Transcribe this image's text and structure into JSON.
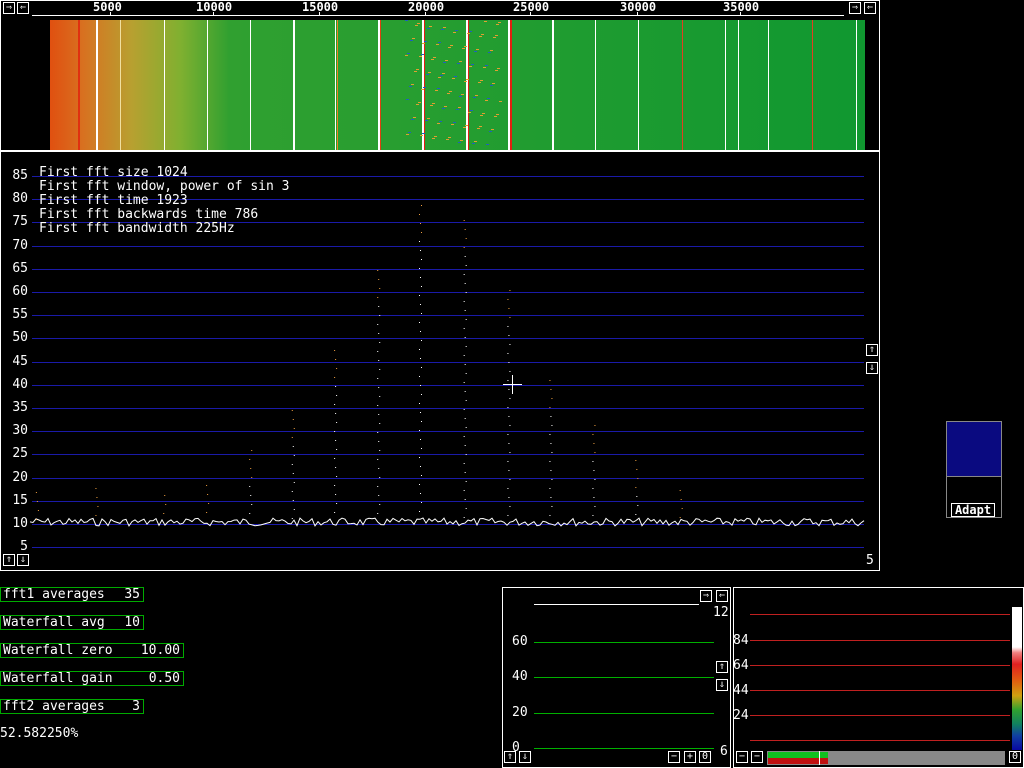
{
  "freq_axis": {
    "labels": [
      "5000",
      "10000",
      "15000",
      "20000",
      "25000",
      "30000",
      "35000"
    ]
  },
  "spectrum": {
    "y_labels": [
      "85",
      "80",
      "75",
      "70",
      "65",
      "60",
      "55",
      "50",
      "45",
      "40",
      "35",
      "30",
      "25",
      "20",
      "15",
      "10",
      "5"
    ],
    "info_lines": [
      "First fft size 1024",
      "First fft window, power of sin 3",
      "First fft time 1923",
      "First fft backwards time 786",
      "First fft bandwidth 225Hz"
    ],
    "corner_value": "5"
  },
  "params": [
    {
      "label": "fft1 averages",
      "value": "35"
    },
    {
      "label": "Waterfall avg",
      "value": "10"
    },
    {
      "label": "Waterfall zero",
      "value": "10.00"
    },
    {
      "label": "Waterfall gain",
      "value": "0.50"
    },
    {
      "label": "fft2 averages",
      "value": "3"
    }
  ],
  "status_percent": "52.582250%",
  "adapt_label": "Adapt",
  "mid_graph": {
    "y_labels": [
      "60",
      "40",
      "20",
      "0"
    ],
    "top_right": "12",
    "bottom_right": "6",
    "zero_box": "0"
  },
  "right_graph": {
    "y_labels": [
      "84",
      "64",
      "44",
      "24"
    ],
    "zero_box": "0"
  },
  "buttons": {
    "arrow_left": "⇐",
    "arrow_right": "⇒",
    "arrow_up": "⇑",
    "arrow_down": "⇓",
    "minus": "−",
    "plus": "+"
  },
  "colors": {
    "grid_blue": "#1a1aa8",
    "panel_green": "#00aa00",
    "adapt_blue": "#0a0a80"
  }
}
